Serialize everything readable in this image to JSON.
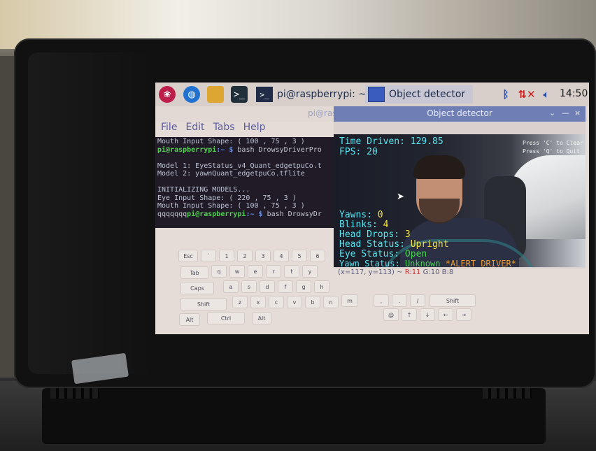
{
  "taskbar": {
    "terminal_task": "pi@raspberrypi: ~",
    "detector_task": "Object detector",
    "clock": "14:50",
    "icons": [
      "raspberry-menu-icon",
      "browser-icon",
      "file-manager-icon",
      "terminal-icon",
      "bluetooth-icon",
      "network-disconnected-icon",
      "volume-icon"
    ]
  },
  "terminal": {
    "title": "pi@ras",
    "menu": [
      "File",
      "Edit",
      "Tabs",
      "Help"
    ],
    "lines": [
      {
        "text": "Mouth Input Shape:  ( 100 , 75 , 3 )"
      },
      {
        "user": "pi@raspberrypi",
        "path": ":~ $",
        "cmd": " bash DrowsyDriverPro"
      },
      {
        "text": ""
      },
      {
        "text": "Model 1: EyeStatus_v4_Quant_edgetpuCo.t"
      },
      {
        "text": "Model 2: yawnQuant_edgetpuCo.tflite"
      },
      {
        "text": ""
      },
      {
        "text": "INITIALIZING MODELS..."
      },
      {
        "text": "Eye Input Shape:   ( 220 , 75 , 3 )"
      },
      {
        "text": "Mouth Input Shape: ( 100 , 75 , 3 )"
      },
      {
        "prefix": "qqqqqqq",
        "user": "pi@raspberrypi",
        "path": ":~ $",
        "cmd": " bash DrowsyDr"
      }
    ]
  },
  "keyboard": {
    "rows": [
      [
        "Esc",
        "`",
        "1",
        "2",
        "3",
        "4",
        "5",
        "6"
      ],
      [
        "Tab",
        "q",
        "w",
        "e",
        "r",
        "t",
        "y"
      ],
      [
        "Caps",
        "a",
        "s",
        "d",
        "f",
        "g",
        "h"
      ],
      [
        "Shift",
        "z",
        "x",
        "c",
        "v",
        "b",
        "n",
        "m",
        ",",
        ".",
        "/",
        "Shift"
      ],
      [
        "Alt",
        "Ctrl",
        "Alt",
        "@",
        "↑",
        "↓",
        "←",
        "→"
      ]
    ]
  },
  "detector": {
    "title": "Object detector",
    "controls": {
      "minimize": "⌄",
      "maximize": "—",
      "close": "×"
    },
    "overlay": {
      "time_driven": "Time Driven: 129.85",
      "fps": "FPS: 20",
      "hint_clear": "Press 'C' to Clear",
      "hint_quit": "Press 'Q' to Quit",
      "yawns_label": "Yawns:",
      "yawns_value": "0",
      "blinks_label": "Blinks:",
      "blinks_value": "4",
      "head_drops_label": "Head Drops:",
      "head_drops_value": "3",
      "head_status_label": "Head Status:",
      "head_status_value": "Upright",
      "eye_status_label": "Eye Status:",
      "eye_status_value": "Open",
      "yawn_status_label": "Yawn Status:",
      "yawn_status_value": "Unknown",
      "alert": "*ALERT DRIVER*"
    },
    "statusbar": {
      "coords": "(x=117, y=113) ~",
      "r": "R:11",
      "g": "G:10",
      "b": "B:8"
    }
  },
  "colors": {
    "overlay_cyan": "#54e6f2",
    "overlay_yellow": "#f3e23c",
    "overlay_green": "#43d64b",
    "alert_orange": "#f0a030"
  }
}
